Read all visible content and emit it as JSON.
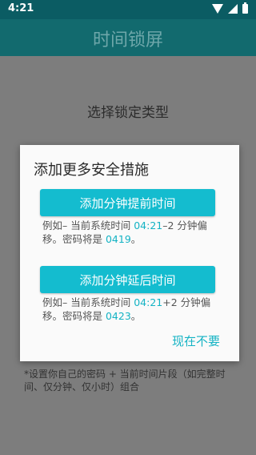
{
  "status_bar": {
    "time": "4:21"
  },
  "app_bar": {
    "title": "时间锁屏"
  },
  "page": {
    "subtitle": "选择锁定类型"
  },
  "dialog": {
    "title": "添加更多安全措施",
    "option1": {
      "button_label": "添加分钟提前时间",
      "desc_prefix": "例如– 当前系统时间 ",
      "time": "04:21",
      "desc_mid": "–2 分钟偏移。密码将是 ",
      "code": "0419",
      "desc_suffix": "。"
    },
    "option2": {
      "button_label": "添加分钟延后时间",
      "desc_prefix": "例如– 当前系统时间 ",
      "time": "04:21",
      "desc_mid": "+2 分钟偏移。密码将是 ",
      "code": "0423",
      "desc_suffix": "。"
    },
    "dismiss_label": "现在不要"
  },
  "footer_note": "*设置你自己的密码 + 当前时间片段（如完整时间、仅分钟、仅小时）组合",
  "colors": {
    "accent": "#14bccf",
    "status_bar": "#0b5c63",
    "app_bar": "#126a6e"
  }
}
